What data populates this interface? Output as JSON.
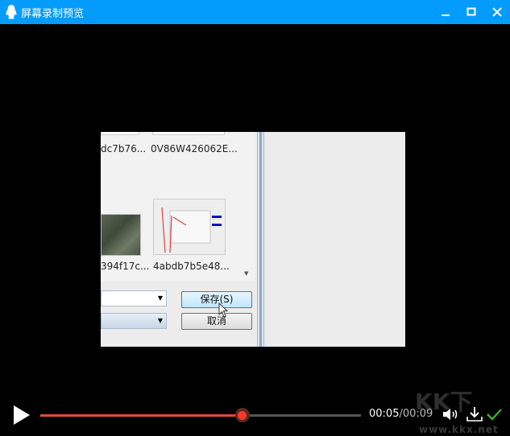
{
  "window": {
    "title": "屏幕录制预览",
    "logo_icon": "qq-penguin-icon",
    "accent": "#049cfa"
  },
  "video_frame": {
    "thumbnails": [
      "dc7b76...",
      "0V86W426062E...",
      "394f17c...",
      "4abdb7b5e48..."
    ],
    "save_button": "保存(S)",
    "cancel_button": "取消"
  },
  "player": {
    "current_time": "00:05",
    "total_time": "00:09",
    "separator": "/",
    "progress": 0.63,
    "progress_color": "#e6493a"
  },
  "watermark": {
    "logo": "KKX下载",
    "url": "www.kkx.net"
  }
}
